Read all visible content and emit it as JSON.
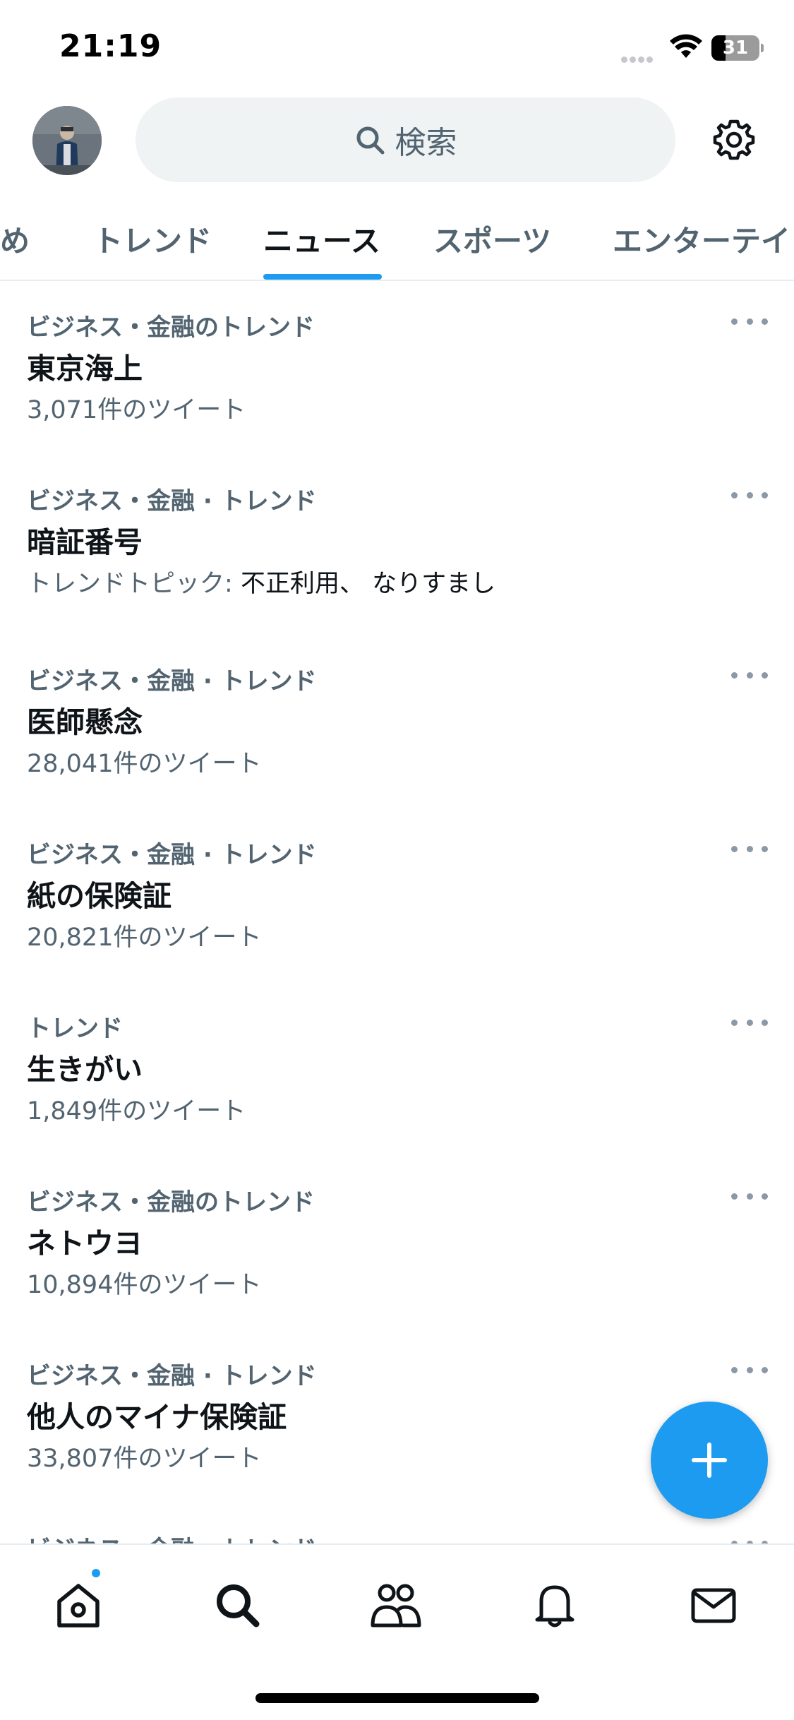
{
  "status_bar": {
    "time": "21:19",
    "battery": "31"
  },
  "header": {
    "search_placeholder": "検索"
  },
  "tabs": [
    {
      "label": "め"
    },
    {
      "label": "トレンド"
    },
    {
      "label": "ニュース"
    },
    {
      "label": "スポーツ"
    },
    {
      "label": "エンターテイ"
    }
  ],
  "trends": [
    {
      "category": "ビジネス・金融のトレンド",
      "title": "東京海上",
      "meta": "3,071件のツイート"
    },
    {
      "category": "ビジネス・金融 · トレンド",
      "title": "暗証番号",
      "meta_label": "トレンドトピック:",
      "meta_topics": "不正利用、 なりすまし"
    },
    {
      "category": "ビジネス・金融 · トレンド",
      "title": "医師懸念",
      "meta": "28,041件のツイート"
    },
    {
      "category": "ビジネス・金融 · トレンド",
      "title": "紙の保険証",
      "meta": "20,821件のツイート"
    },
    {
      "category": "トレンド",
      "title": "生きがい",
      "meta": "1,849件のツイート"
    },
    {
      "category": "ビジネス・金融のトレンド",
      "title": "ネトウヨ",
      "meta": "10,894件のツイート"
    },
    {
      "category": "ビジネス・金融 · トレンド",
      "title": "他人のマイナ保険証",
      "meta": "33,807件のツイート"
    },
    {
      "category": "ビジネス・金融 · トレンド"
    }
  ],
  "icons": {
    "fab": "plus-icon",
    "nav": [
      "home-icon",
      "search-icon",
      "communities-icon",
      "bell-icon",
      "mail-icon"
    ]
  },
  "colors": {
    "accent": "#1d9bf0",
    "secondary_text": "#536471",
    "primary_text": "#0f1419"
  }
}
